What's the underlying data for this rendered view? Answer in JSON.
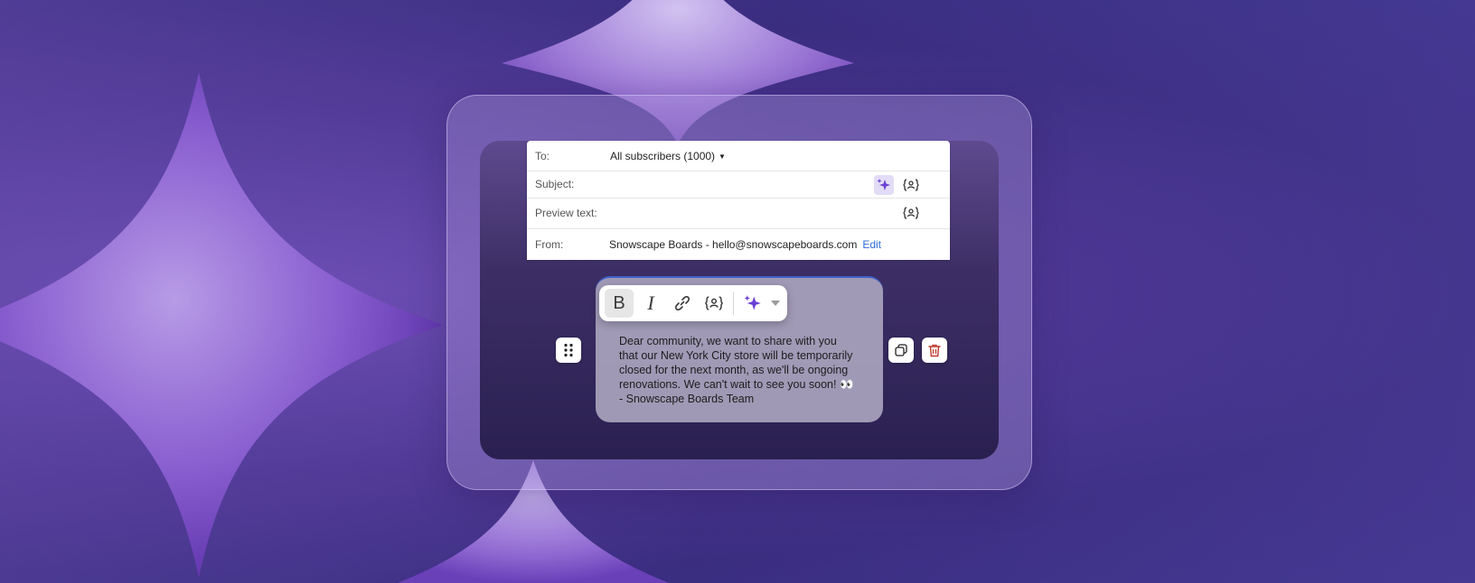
{
  "email": {
    "to_label": "To:",
    "to_value": "All subscribers (1000)",
    "subject_label": "Subject:",
    "subject_value": "",
    "preview_label": "Preview text:",
    "preview_value": "",
    "from_label": "From:",
    "from_value": "Snowscape Boards - hello@snowscapeboards.com",
    "edit_link": "Edit"
  },
  "toolbar": {
    "bold": "B",
    "italic": "I"
  },
  "editor": {
    "body": "Dear community, we want to share with you\nthat our New York City store will be temporarily\nclosed for the next month, as we'll be ongoing\nrenovations. We can't wait to see you soon! 👀\n- Snowscape Boards Team"
  },
  "colors": {
    "accent": "#6a3fd6",
    "link": "#2b6bd6",
    "delete": "#c0392b",
    "background": "#4a3590"
  },
  "icons": [
    "sparkle-icon",
    "personalize-icon",
    "link-icon",
    "chevron-down-icon",
    "drag-handle-icon",
    "duplicate-icon",
    "trash-icon"
  ]
}
